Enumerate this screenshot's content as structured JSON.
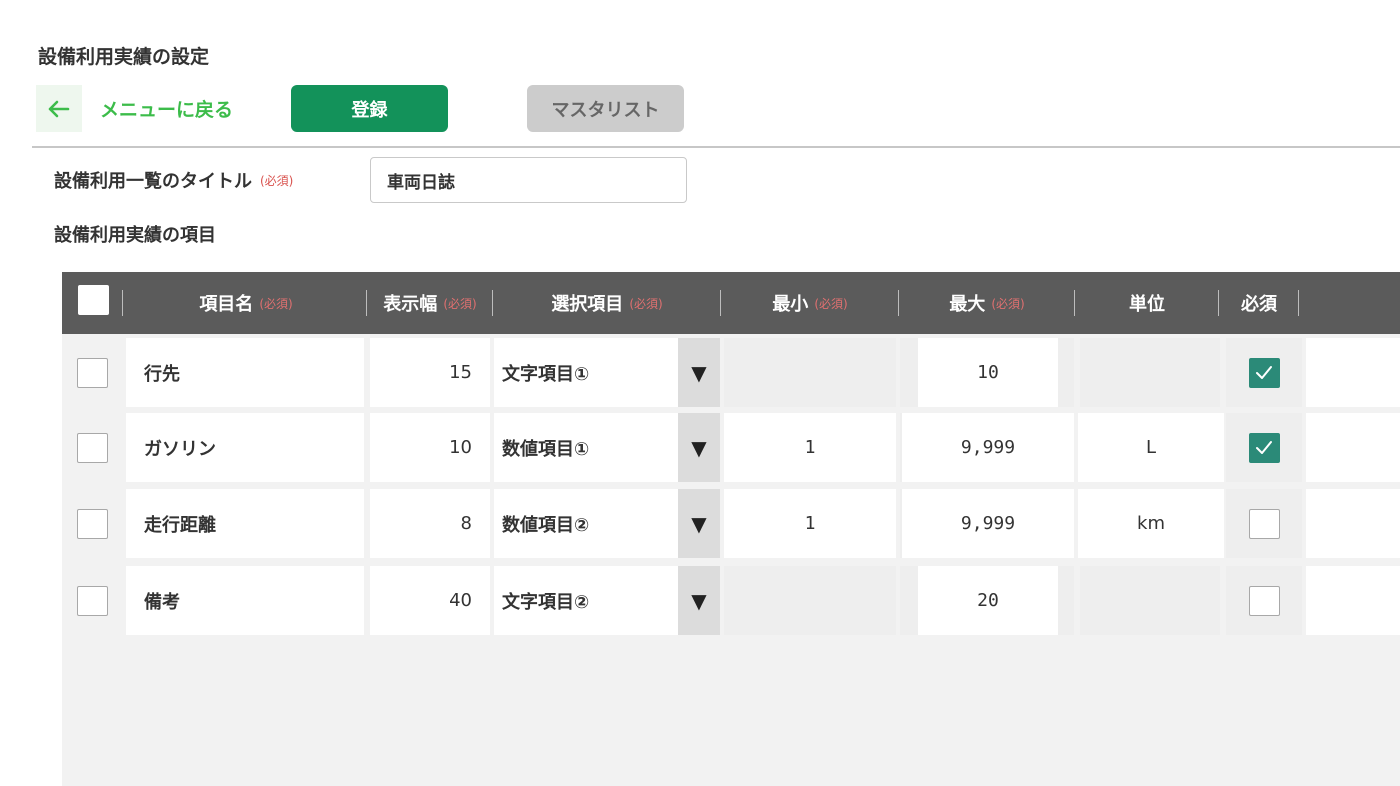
{
  "page": {
    "heading": "設備利用実績の設定"
  },
  "toolbar": {
    "back_label": "メニューに戻る",
    "register_label": "登録",
    "master_list_label": "マスタリスト"
  },
  "title_field": {
    "label": "設備利用一覧のタイトル",
    "required_tag": "(必須)",
    "value": "車両日誌"
  },
  "section": {
    "title": "設備利用実績の項目"
  },
  "table": {
    "required_tag": "(必須)",
    "headers": {
      "name": "項目名",
      "width": "表示幅",
      "select": "選択項目",
      "min": "最小",
      "max": "最大",
      "unit": "単位",
      "required": "必須"
    },
    "rows": [
      {
        "name": "行先",
        "width": "15",
        "select": "文字項目①",
        "min": "",
        "max": "10",
        "unit": "",
        "required": true
      },
      {
        "name": "ガソリン",
        "width": "10",
        "select": "数値項目①",
        "min": "1",
        "max": "9,999",
        "unit": "L",
        "required": true
      },
      {
        "name": "走行距離",
        "width": "8",
        "select": "数値項目②",
        "min": "1",
        "max": "9,999",
        "unit": "km",
        "required": false
      },
      {
        "name": "備考",
        "width": "40",
        "select": "文字項目②",
        "min": "",
        "max": "20",
        "unit": "",
        "required": false
      }
    ]
  },
  "icons": {
    "back": "arrow-left-icon",
    "dropdown": "triangle-down-icon",
    "check": "checkmark-icon"
  },
  "colors": {
    "accent_green": "#13925a",
    "link_green": "#3cbc4a",
    "header_gray": "#5b5b5b",
    "check_teal": "#2b8a78",
    "required_red": "#d9534f"
  }
}
